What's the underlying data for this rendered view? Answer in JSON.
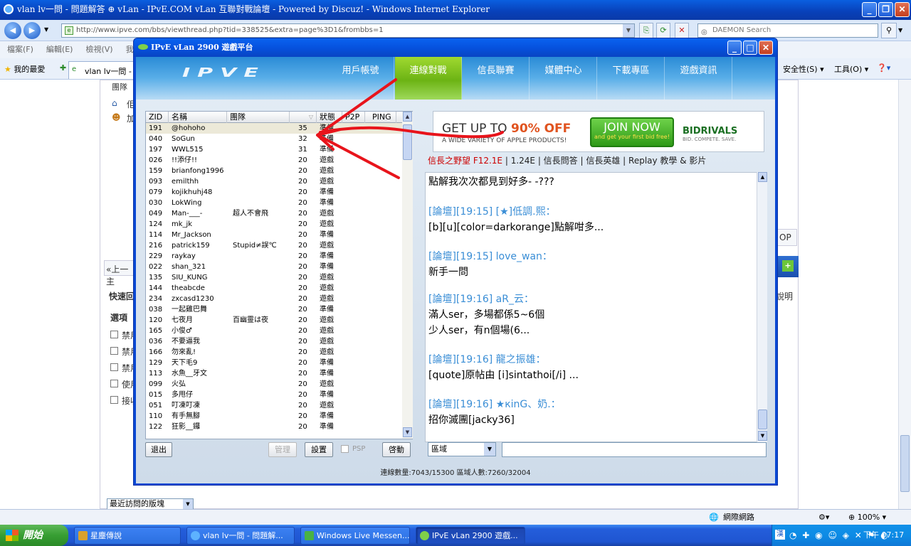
{
  "ie": {
    "title": "vlan lv一問 - 問題解答 ⊕ vLan - IPvE.COM vLan 互聯對戰論壇 - Powered by Discuz! - Windows Internet Explorer",
    "url": "http://www.ipve.com/bbs/viewthread.php?tid=338525&extra=page%3D1&frombbs=1",
    "search_placeholder": "DAEMON Search",
    "menu": [
      "檔案(F)",
      "編輯(E)",
      "檢視(V)",
      "我"
    ],
    "favorites": "我的最愛",
    "tab_label": "vlan lv一問 - ...",
    "cmd_safety": "安全性(S)",
    "cmd_tools": "工具(O)",
    "status_zone": "網際網路",
    "zoom": "100%"
  },
  "page": {
    "team_label": "團隊",
    "prev": "«上一主",
    "quick_reply": "快速回",
    "options_label": "選項",
    "checks": [
      "禁用",
      "禁用",
      "禁用",
      "使用",
      "接收"
    ],
    "top_btn": "OP",
    "explain": "說明",
    "recent_select": "最近訪問的版塊",
    "misc_a": "佢",
    "misc_b": "加"
  },
  "vlan": {
    "title": "IPvE vLan 2900 遊戲平台",
    "logo": "IPVE",
    "nav": [
      "用戶帳號",
      "連線對戰",
      "信長聯賽",
      "媒體中心",
      "下載專區",
      "遊戲資訊"
    ],
    "columns": {
      "zid": "ZID",
      "name": "名稱",
      "team": "團隊",
      "level": "",
      "status": "狀態",
      "p2p": "P2P",
      "ping": "PING"
    },
    "users": [
      {
        "zid": "191",
        "name": "@hohoho",
        "team": "",
        "level": "35",
        "status": "準備"
      },
      {
        "zid": "040",
        "name": "SoGun",
        "team": "",
        "level": "32",
        "status": "準備"
      },
      {
        "zid": "197",
        "name": "WWL515",
        "team": "",
        "level": "31",
        "status": "準備"
      },
      {
        "zid": "026",
        "name": "!!添仔!!",
        "team": "",
        "level": "20",
        "status": "遊戲"
      },
      {
        "zid": "159",
        "name": "brianfong1996",
        "team": "",
        "level": "20",
        "status": "遊戲"
      },
      {
        "zid": "093",
        "name": "emilthh",
        "team": "",
        "level": "20",
        "status": "遊戲"
      },
      {
        "zid": "079",
        "name": "kojikhuhj48",
        "team": "",
        "level": "20",
        "status": "準備"
      },
      {
        "zid": "030",
        "name": "LokWing",
        "team": "",
        "level": "20",
        "status": "準備"
      },
      {
        "zid": "049",
        "name": "Man-___-",
        "team": "超人不會飛",
        "level": "20",
        "status": "遊戲"
      },
      {
        "zid": "124",
        "name": "mk_jk",
        "team": "",
        "level": "20",
        "status": "遊戲"
      },
      {
        "zid": "114",
        "name": "Mr_Jackson",
        "team": "",
        "level": "20",
        "status": "準備"
      },
      {
        "zid": "216",
        "name": "patrick159",
        "team": "Stupid≠誤℃",
        "level": "20",
        "status": "遊戲"
      },
      {
        "zid": "229",
        "name": "raykay",
        "team": "",
        "level": "20",
        "status": "準備"
      },
      {
        "zid": "022",
        "name": "shan_321",
        "team": "",
        "level": "20",
        "status": "準備"
      },
      {
        "zid": "135",
        "name": "SIU_KUNG",
        "team": "",
        "level": "20",
        "status": "遊戲"
      },
      {
        "zid": "144",
        "name": "theabcde",
        "team": "",
        "level": "20",
        "status": "遊戲"
      },
      {
        "zid": "234",
        "name": "zxcasd1230",
        "team": "",
        "level": "20",
        "status": "遊戲"
      },
      {
        "zid": "038",
        "name": "一起雞巴舞",
        "team": "",
        "level": "20",
        "status": "準備"
      },
      {
        "zid": "120",
        "name": "七夜月",
        "team": "百幽靈は夜",
        "level": "20",
        "status": "遊戲"
      },
      {
        "zid": "165",
        "name": "小俊♂",
        "team": "",
        "level": "20",
        "status": "遊戲"
      },
      {
        "zid": "036",
        "name": "不要逼我",
        "team": "",
        "level": "20",
        "status": "遊戲"
      },
      {
        "zid": "166",
        "name": "勿來亂!",
        "team": "",
        "level": "20",
        "status": "遊戲"
      },
      {
        "zid": "129",
        "name": "天下毛9",
        "team": "",
        "level": "20",
        "status": "準備"
      },
      {
        "zid": "113",
        "name": "水魚__牙文",
        "team": "",
        "level": "20",
        "status": "準備"
      },
      {
        "zid": "099",
        "name": "火弘",
        "team": "",
        "level": "20",
        "status": "遊戲"
      },
      {
        "zid": "015",
        "name": "多甩仔",
        "team": "",
        "level": "20",
        "status": "準備"
      },
      {
        "zid": "051",
        "name": "叮凍叮凍",
        "team": "",
        "level": "20",
        "status": "遊戲"
      },
      {
        "zid": "110",
        "name": "有手無腳",
        "team": "",
        "level": "20",
        "status": "準備"
      },
      {
        "zid": "122",
        "name": "狂影__鑼",
        "team": "",
        "level": "20",
        "status": "準備"
      }
    ],
    "buttons": {
      "exit": "退出",
      "manage": "管理",
      "settings": "設置",
      "psp": "PSP",
      "start": "啓動"
    },
    "ad": {
      "line1_a": "GET UP TO ",
      "line1_b": "90% OFF",
      "line2": "A WIDE VARIETY OF APPLE PRODUCTS!",
      "join": "JOIN NOW",
      "join_sub": "and get your first bid free!",
      "brand": "BIDRIVALS",
      "brand_sub": "BID. COMPETE. SAVE."
    },
    "links": {
      "red": "信長之野望 F12.1E",
      "rest": " | 1.24E | 信長問答 | 信長英雄 | Replay 教學 & 影片"
    },
    "chat": [
      {
        "head": "",
        "body": "點解我次次都見到好多- -???"
      },
      {
        "head": "[論壇][19:15] [★]低調.熙：",
        "body": "[b][u][color=darkorange]點解咁多..."
      },
      {
        "head": "[論壇][19:15] love_wan：",
        "body": "新手一問"
      },
      {
        "head": "[論壇][19:16] aR_云：",
        "body": "滿人ser，多場都係5~6個"
      },
      {
        "head": "",
        "body": "少人ser，有n個場(6..."
      },
      {
        "head": "[論壇][19:16] 龍之振雄：",
        "body": "[quote]原帖由 [i]sintathoi[/i] ..."
      },
      {
        "head": "[論壇][19:16] ★кinG、奶.：",
        "body": "招你滅團[jacky36]"
      }
    ],
    "region": "區域",
    "status": "連線數量:7043/15300    區域人數:7260/32004"
  },
  "taskbar": {
    "start": "開始",
    "items": [
      "星塵傳說",
      "vlan lv一問 - 問題解...",
      "Windows Live Messen...",
      "IPvE vLan 2900 遊戲..."
    ],
    "clock": "下午 07:17"
  }
}
